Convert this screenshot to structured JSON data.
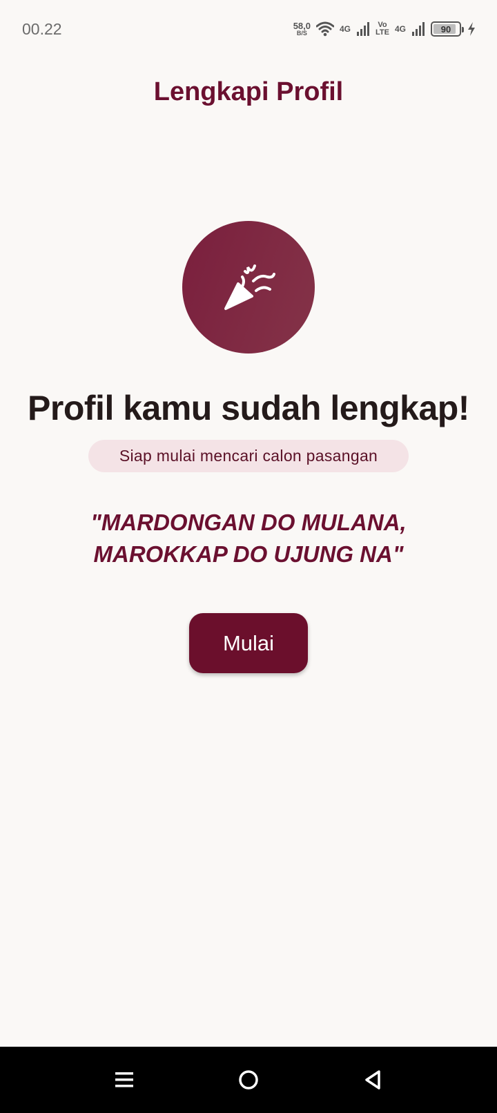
{
  "status_bar": {
    "time": "00.22",
    "net_speed_value": "58,0",
    "net_speed_unit": "B/S",
    "network_1": "4G",
    "volte_top": "Vo",
    "volte_bottom": "LTE",
    "network_2": "4G",
    "battery_level": "90",
    "battery_fraction": 0.9
  },
  "header": {
    "title": "Lengkapi Profil"
  },
  "hero": {
    "icon": "party-popper-icon",
    "headline": "Profil kamu sudah lengkap!",
    "badge": "Siap mulai mencari calon pasangan",
    "quote_line1": "\"MARDONGAN DO MULANA,",
    "quote_line2": "MAROKKAP DO UJUNG NA\"",
    "start_label": "Mulai"
  },
  "colors": {
    "brand": "#6b0f2c",
    "background": "#faf8f6",
    "badge_bg": "#f4e3e6",
    "text_dark": "#241a1a"
  }
}
